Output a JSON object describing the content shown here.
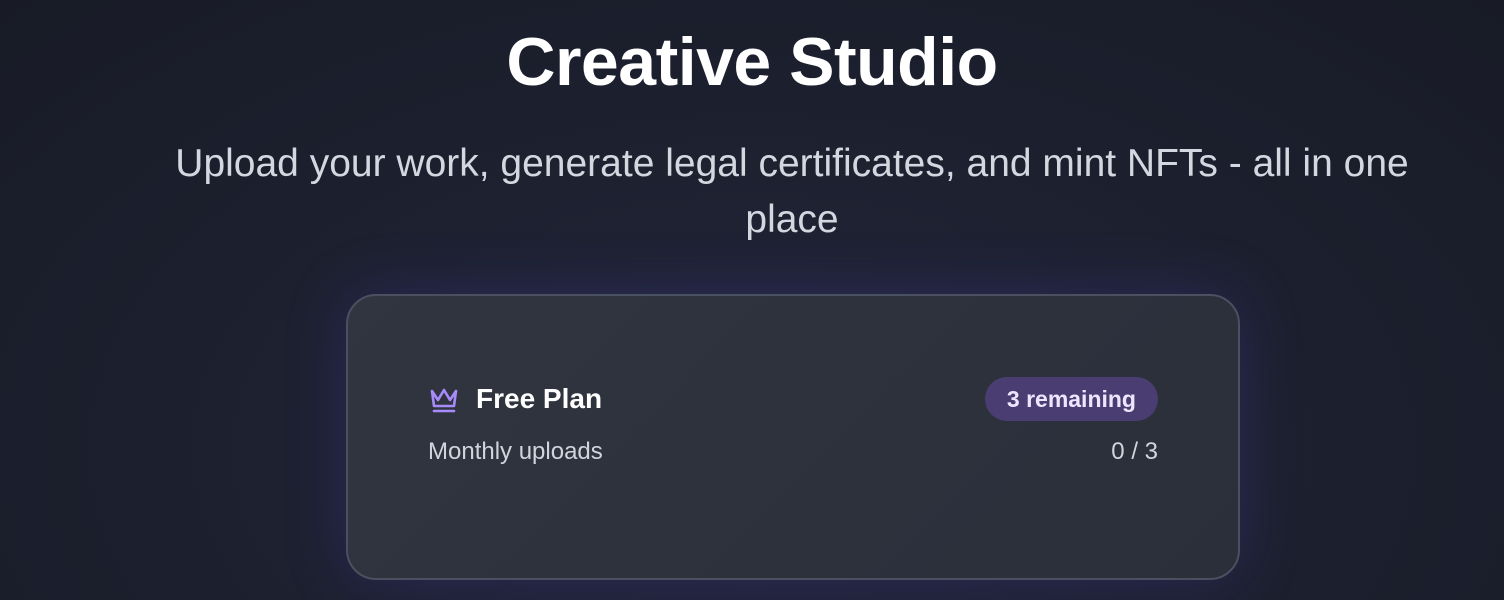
{
  "hero": {
    "title": "Creative Studio",
    "subtitle": "Upload your work, generate legal certificates, and mint NFTs - all in one place"
  },
  "plan_card": {
    "icon": "crown-icon",
    "plan_name": "Free Plan",
    "badge": "3 remaining",
    "usage_label": "Monthly uploads",
    "usage_value": "0 / 3",
    "accent_color": "#a78bfa",
    "badge_background": "#4a3d72"
  }
}
